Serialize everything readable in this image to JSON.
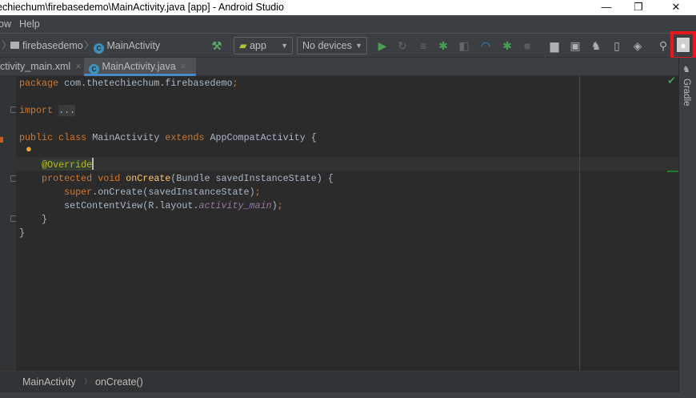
{
  "window": {
    "title": "echiechum\\firebasedemo\\MainActivity.java [app] - Android Studio",
    "minimize": "—",
    "maximize": "❐",
    "close": "✕"
  },
  "menu": {
    "items": [
      "ow",
      "Help"
    ]
  },
  "nav": {
    "breadcrumb": [
      "firebasedemo",
      "MainActivity"
    ],
    "run_config": "app",
    "device": "No devices"
  },
  "tabs": [
    {
      "label": "ctivity_main.xml",
      "close": "×"
    },
    {
      "label": "MainActivity.java",
      "close": "×"
    }
  ],
  "right_panel": {
    "gradle_label": "Gradle"
  },
  "code": {
    "lines": [
      {
        "tokens": [
          {
            "t": "package ",
            "c": "kw"
          },
          {
            "t": "com.thetechiechum.firebasedemo",
            "c": "pl"
          },
          {
            "t": ";",
            "c": "kw"
          }
        ]
      },
      {
        "tokens": []
      },
      {
        "tokens": [
          {
            "t": "import ",
            "c": "kw"
          },
          {
            "t": "...",
            "c": "fold"
          }
        ]
      },
      {
        "tokens": []
      },
      {
        "tokens": [
          {
            "t": "public class ",
            "c": "kw"
          },
          {
            "t": "MainActivity ",
            "c": "pl"
          },
          {
            "t": "extends ",
            "c": "kw"
          },
          {
            "t": "AppCompatActivity {",
            "c": "pl"
          }
        ]
      },
      {
        "tokens": []
      },
      {
        "tokens": [
          {
            "t": "    ",
            "c": "pl"
          },
          {
            "t": "@Override",
            "c": "an"
          }
        ]
      },
      {
        "tokens": [
          {
            "t": "    protected void ",
            "c": "kw"
          },
          {
            "t": "onCreate",
            "c": "fn"
          },
          {
            "t": "(Bundle savedInstanceState) {",
            "c": "pl"
          }
        ]
      },
      {
        "tokens": [
          {
            "t": "        super",
            "c": "kw"
          },
          {
            "t": ".onCreate(savedInstanceState)",
            "c": "pl"
          },
          {
            "t": ";",
            "c": "kw"
          }
        ]
      },
      {
        "tokens": [
          {
            "t": "        setContentView(R.layout.",
            "c": "pl"
          },
          {
            "t": "activity_main",
            "c": "fd"
          },
          {
            "t": ")",
            "c": "pl"
          },
          {
            "t": ";",
            "c": "kw"
          }
        ]
      },
      {
        "tokens": [
          {
            "t": "    }",
            "c": "pl"
          }
        ]
      },
      {
        "tokens": [
          {
            "t": "}",
            "c": "pl"
          }
        ]
      }
    ]
  },
  "status_breadcrumb": [
    "MainActivity",
    "onCreate()"
  ]
}
